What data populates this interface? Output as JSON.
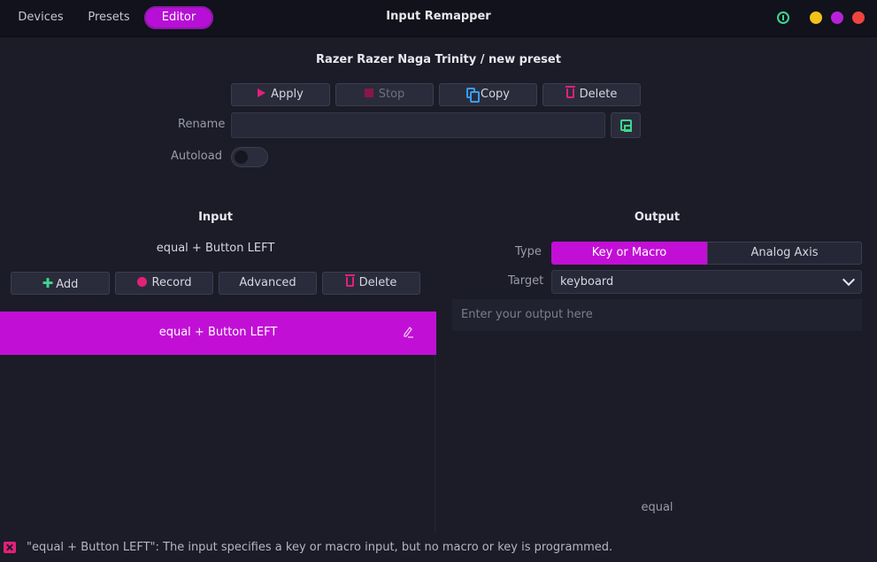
{
  "header": {
    "tabs": [
      "Devices",
      "Presets",
      "Editor"
    ],
    "active_tab": "Editor",
    "app_title": "Input Remapper",
    "window_buttons": [
      "info-icon",
      "minimize",
      "maximize",
      "close"
    ]
  },
  "preset": {
    "title": "Razer Razer Naga Trinity  /  new preset",
    "buttons": {
      "apply": "Apply",
      "stop": "Stop",
      "copy": "Copy",
      "delete": "Delete"
    },
    "rename_label": "Rename",
    "rename_value": "",
    "autoload_label": "Autoload",
    "autoload_on": false
  },
  "input": {
    "heading": "Input",
    "combination": "equal + Button LEFT",
    "buttons": {
      "add": "Add",
      "record": "Record",
      "advanced": "Advanced",
      "delete": "Delete"
    },
    "mappings": [
      "equal + Button LEFT"
    ]
  },
  "output": {
    "heading": "Output",
    "type_label": "Type",
    "type_options": [
      "Key or Macro",
      "Analog Axis"
    ],
    "type_selected": "Key or Macro",
    "target_label": "Target",
    "target_value": "keyboard",
    "editor_placeholder": "Enter your output here",
    "preview": "equal"
  },
  "status": {
    "message": "\"equal + Button LEFT\": The input specifies a key or macro input, but no macro or key is programmed."
  },
  "colors": {
    "accent": "#c20fd6",
    "background": "#1b1c28",
    "error": "#e3207a",
    "success": "#3ed68f"
  }
}
